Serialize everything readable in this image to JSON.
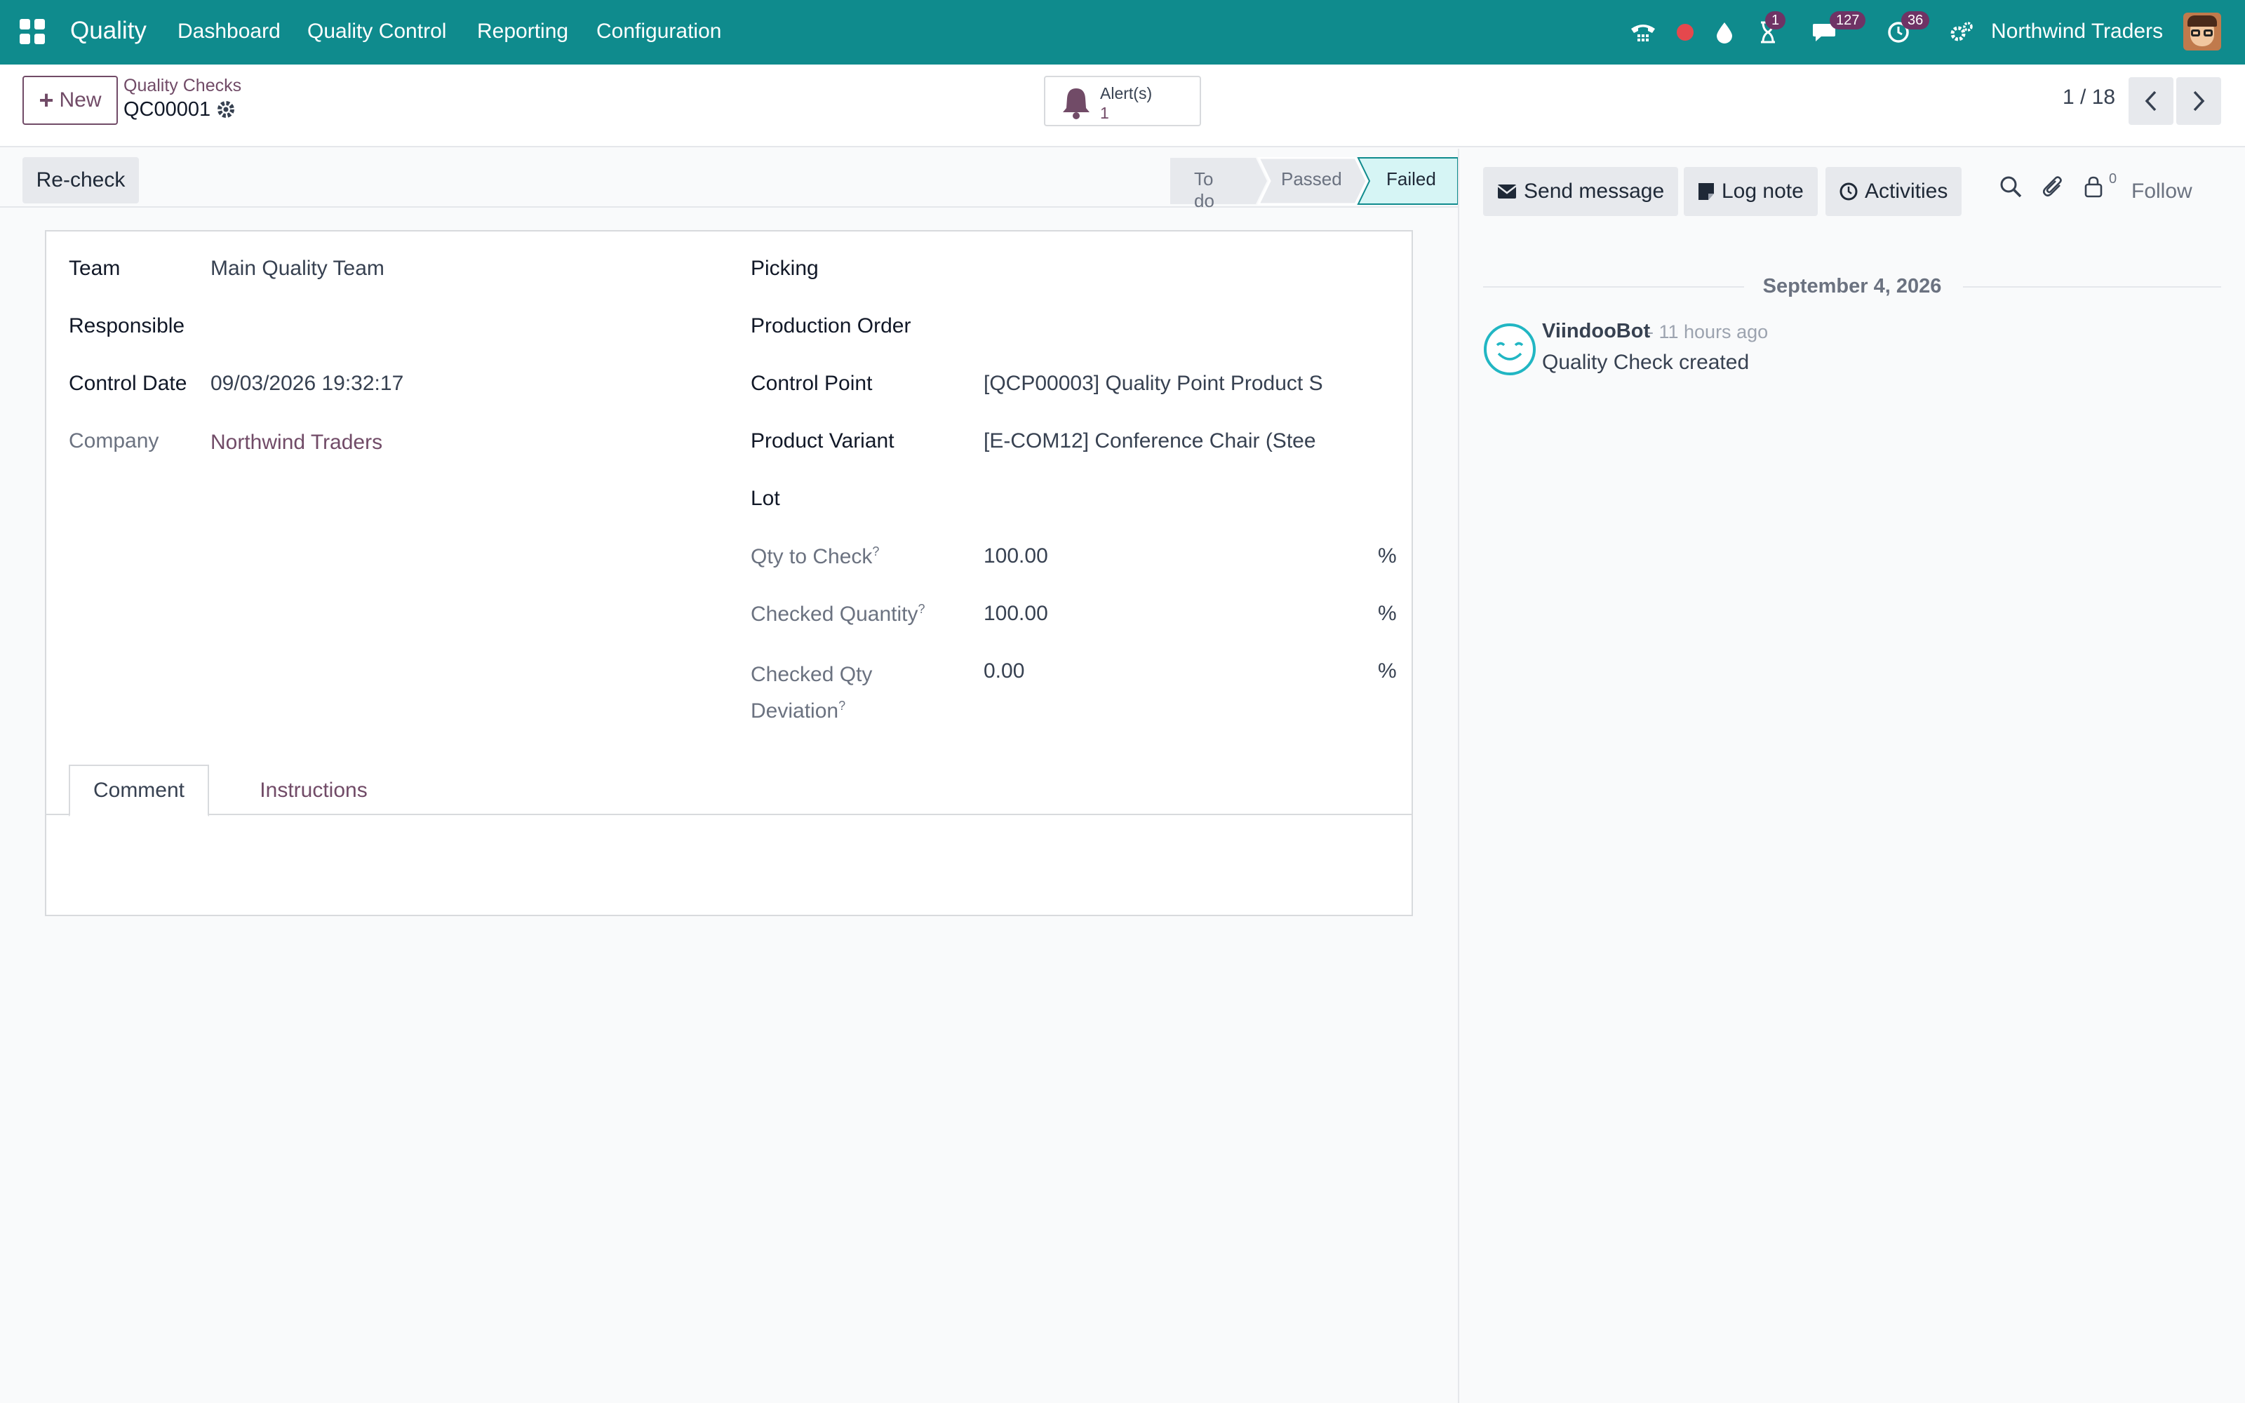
{
  "navbar": {
    "app_name": "Quality",
    "menu": [
      "Dashboard",
      "Quality Control",
      "Reporting",
      "Configuration"
    ],
    "badges": {
      "activity": "1",
      "messages": "127",
      "timer": "36"
    },
    "company": "Northwind Traders",
    "accent_color": "#0f8b8d"
  },
  "control": {
    "new_label": "New",
    "breadcrumb": "Quality Checks",
    "record_name": "QC00001",
    "alert_label": "Alert(s)",
    "alert_count": "1",
    "pager": "1 / 18"
  },
  "status": {
    "recheck_label": "Re-check",
    "stages": [
      "To do",
      "Passed",
      "Failed"
    ],
    "current_stage": "Failed"
  },
  "form": {
    "left": [
      {
        "label": "Team",
        "value": "Main Quality Team"
      },
      {
        "label": "Responsible",
        "value": ""
      },
      {
        "label": "Control Date",
        "value": "09/03/2026 19:32:17"
      },
      {
        "label": "Company",
        "value": "Northwind Traders"
      }
    ],
    "right": [
      {
        "label": "Picking",
        "value": ""
      },
      {
        "label": "Production Order",
        "value": ""
      },
      {
        "label": "Control Point",
        "value": "[QCP00003] Quality Point Product S"
      },
      {
        "label": "Product Variant",
        "value": "[E-COM12] Conference Chair (Stee"
      },
      {
        "label": "Lot",
        "value": ""
      },
      {
        "label": "Qty to Check",
        "value": "100.00",
        "unit": "%",
        "help": "?"
      },
      {
        "label": "Checked Quantity",
        "value": "100.00",
        "unit": "%",
        "help": "?"
      },
      {
        "label_line1": "Checked Qty",
        "label_line2": "Deviation",
        "value": "0.00",
        "unit": "%",
        "help": "?"
      }
    ],
    "tabs": [
      "Comment",
      "Instructions"
    ]
  },
  "chatter": {
    "send_message": "Send message",
    "log_note": "Log note",
    "activities": "Activities",
    "follower_count": "0",
    "follow": "Follow",
    "date": "September 4, 2026",
    "message": {
      "author": "ViindooBot",
      "time": "- 11 hours ago",
      "body": "Quality Check created"
    }
  }
}
